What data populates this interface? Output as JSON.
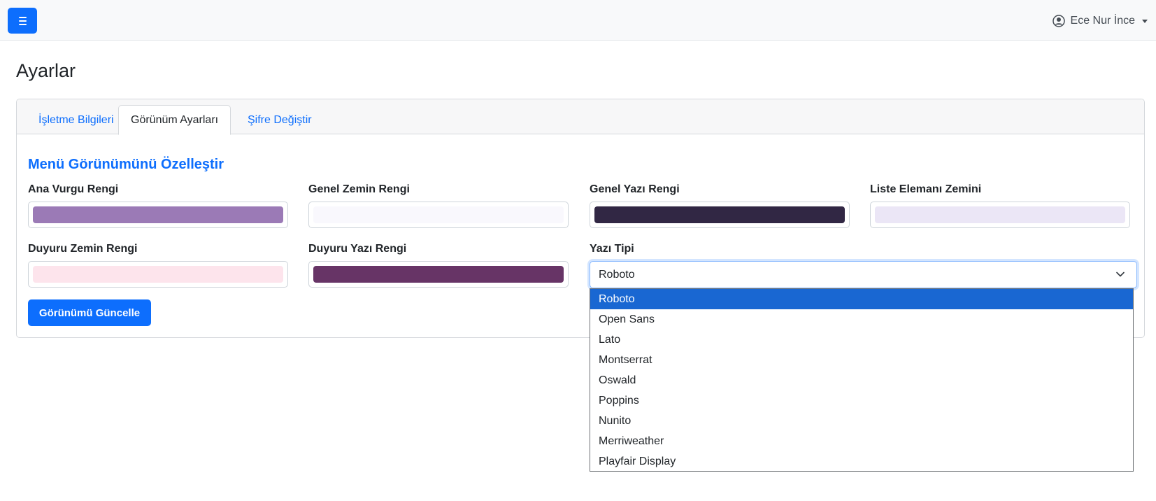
{
  "navbar": {
    "user_name": "Ece Nur İnce"
  },
  "page": {
    "title": "Ayarlar"
  },
  "tabs": [
    {
      "label": "İşletme Bilgileri",
      "active": false
    },
    {
      "label": "Görünüm Ayarları",
      "active": true
    },
    {
      "label": "Şifre Değiştir",
      "active": false
    }
  ],
  "form": {
    "section_title": "Menü Görünümünü Özelleştir",
    "fields": [
      {
        "label": "Ana Vurgu Rengi",
        "color": "#9b7ab6"
      },
      {
        "label": "Genel Zemin Rengi",
        "color": "#f9f8fd"
      },
      {
        "label": "Genel Yazı Rengi",
        "color": "#312744"
      },
      {
        "label": "Liste Elemanı Zemini",
        "color": "#ebe6f6"
      },
      {
        "label": "Duyuru Zemin Rengi",
        "color": "#fde4ec"
      },
      {
        "label": "Duyuru Yazı Rengi",
        "color": "#673466"
      }
    ],
    "font_label": "Yazı Tipi",
    "font_value": "Roboto",
    "font_options": [
      "Roboto",
      "Open Sans",
      "Lato",
      "Montserrat",
      "Oswald",
      "Poppins",
      "Nunito",
      "Merriweather",
      "Playfair Display"
    ],
    "submit_label": "Görünümü Güncelle"
  },
  "colors": {
    "primary": "#0d6efd",
    "dropdown_highlight": "#1967d2"
  }
}
